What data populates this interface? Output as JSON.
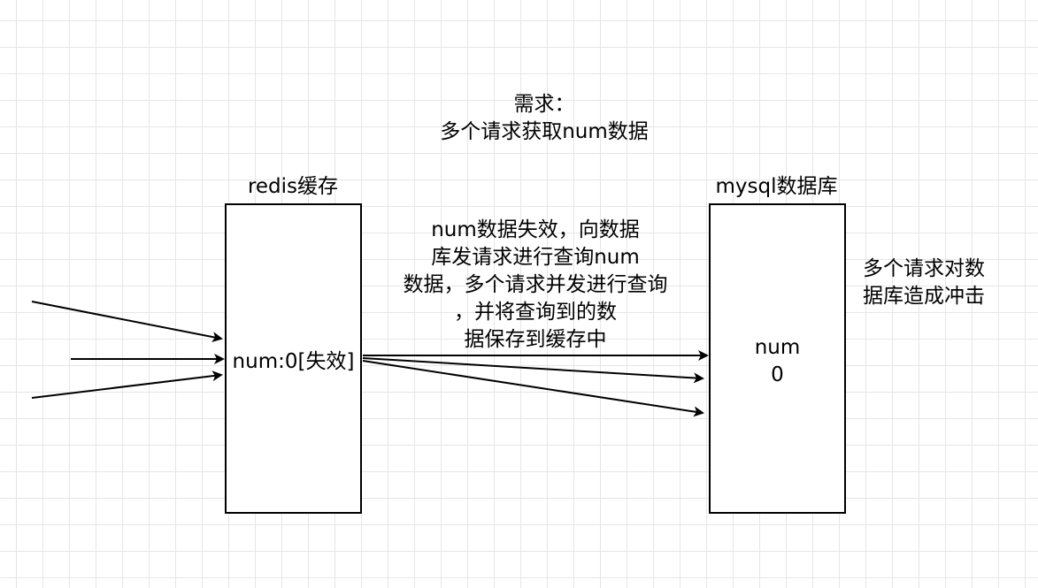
{
  "requirement": {
    "line1": "需求：",
    "line2": "多个请求获取num数据"
  },
  "redis": {
    "title": "redis缓存",
    "content": "num:0[失效]"
  },
  "mysql": {
    "title": "mysql数据库",
    "content_line1": "num",
    "content_line2": "0"
  },
  "middle_note": {
    "line1": "num数据失效，向数据",
    "line2": "库发请求进行查询num",
    "line3": "数据，多个请求并发进行查询",
    "line4": "，并将查询到的数",
    "line5": "据保存到缓存中"
  },
  "impact_note": {
    "line1": "多个请求对数",
    "line2": "据库造成冲击"
  }
}
